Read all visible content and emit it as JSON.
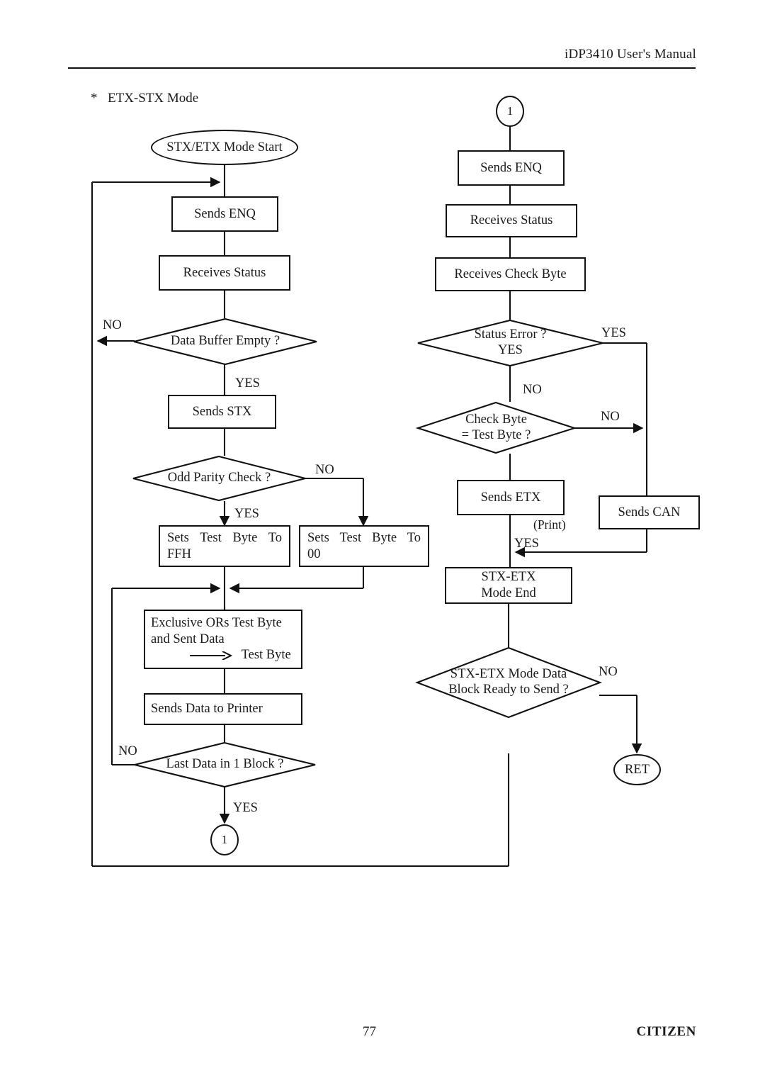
{
  "header": {
    "manual_title": "iDP3410 User's Manual"
  },
  "section": {
    "bullet": "*",
    "title": "ETX-STX Mode"
  },
  "footer": {
    "page_number": "77",
    "brand": "CITIZEN"
  },
  "flow": {
    "left": {
      "start": "STX/ETX Mode Start",
      "sends_enq": "Sends ENQ",
      "receives_status": "Receives Status",
      "data_buffer_empty": "Data Buffer Empty ?",
      "data_buffer_no": "NO",
      "data_buffer_yes": "YES",
      "sends_stx": "Sends STX",
      "odd_parity": "Odd Parity Check ?",
      "odd_parity_no": "NO",
      "odd_parity_yes": "YES",
      "sets_ffh_l1": "Sets  Test  Byte  To",
      "sets_ffh_l2": "FFH",
      "sets_00_l1": "Sets  Test  Byte  To",
      "sets_00_l2": "00",
      "xor_l1": "Exclusive ORs Test Byte",
      "xor_l2": "and Sent Data",
      "xor_l3": "Test Byte",
      "sends_data": "Sends Data to Printer",
      "last_data": "Last Data in 1 Block ?",
      "last_data_no": "NO",
      "last_data_yes": "YES",
      "connector_1": "1"
    },
    "right": {
      "connector_1": "1",
      "sends_enq": "Sends ENQ",
      "receives_status": "Receives Status",
      "receives_check_byte": "Receives Check Byte",
      "status_error_l1": "Status Error ?",
      "status_error_l2": "YES",
      "status_error_yes": "YES",
      "status_error_no": "NO",
      "check_byte_l1": "Check Byte",
      "check_byte_l2": "= Test Byte ?",
      "check_byte_no": "NO",
      "sends_etx": "Sends ETX",
      "print_note": "(Print)",
      "sends_can": "Sends CAN",
      "can_yes": "YES",
      "mode_end_l1": "STX-ETX",
      "mode_end_l2": "Mode End",
      "block_ready_l1": "STX-ETX Mode Data",
      "block_ready_l2": "Block Ready to Send ?",
      "block_ready_no": "NO",
      "ret": "RET"
    }
  },
  "colors": {
    "ink": "#111111",
    "paper": "#ffffff"
  }
}
